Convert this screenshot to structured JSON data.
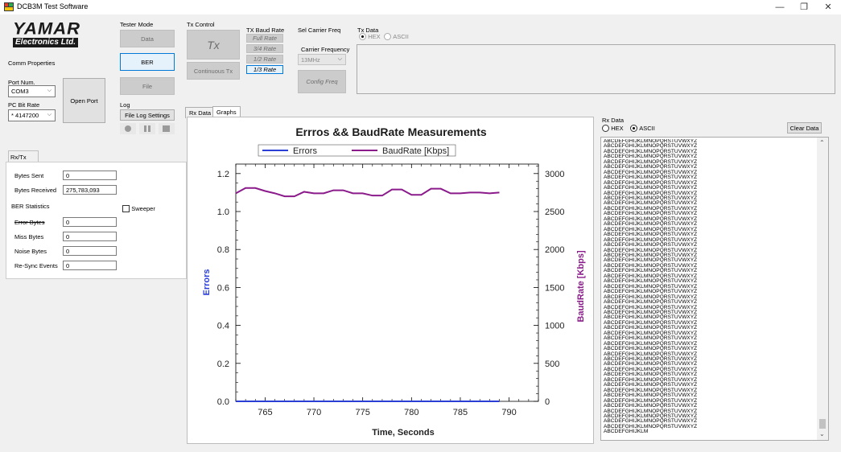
{
  "window": {
    "title": "DCB3M Test Software",
    "minimize": "—",
    "maximize": "❐",
    "close": "✕"
  },
  "logo": {
    "line1": "YAMAR",
    "line2": "Electronics Ltd."
  },
  "comm": {
    "title": "Comm Properties",
    "port_label": "Port Num.",
    "port_value": "COM3",
    "rate_label": "PC Bit Rate",
    "rate_value": "* 4147200",
    "open_port": "Open Port"
  },
  "tester_mode": {
    "title": "Tester Mode",
    "data": "Data",
    "ber": "BER",
    "file": "File"
  },
  "log": {
    "title": "Log",
    "settings": "File Log Settings"
  },
  "tx_control": {
    "title": "Tx Control",
    "tx": "Tx",
    "continuous": "Continuous Tx"
  },
  "tx_baud": {
    "title": "TX Baud Rate",
    "options": [
      "Full Rate",
      "3/4 Rate",
      "1/2 Rate",
      "1/3 Rate"
    ]
  },
  "carrier": {
    "title": "Sel Carrier Freq",
    "label": "Carrier Frequency",
    "value": "13MHz",
    "config": "Config Freq"
  },
  "tx_data": {
    "title": "Tx Data",
    "hex": "HEX",
    "ascii": "ASCII"
  },
  "rxtx_ber": {
    "tab": "Rx/Tx BER",
    "bytes_sent_label": "Bytes Sent",
    "bytes_sent": "0",
    "bytes_received_label": "Bytes Received",
    "bytes_received": "275,783,093",
    "stats_title": "BER Statistics",
    "sweeper": "Sweeper",
    "error_bytes_label": "Error Bytes",
    "error_bytes": "0",
    "miss_bytes_label": "Miss Bytes",
    "miss_bytes": "0",
    "noise_bytes_label": "Noise Bytes",
    "noise_bytes": "0",
    "resync_label": "Re-Sync Events",
    "resync": "0"
  },
  "tabs": {
    "rx_data": "Rx Data",
    "graphs": "Graphs"
  },
  "rx_panel": {
    "title": "Rx Data",
    "hex": "HEX",
    "ascii": "ASCII",
    "clear": "Clear Data",
    "line": "ABCDEFGHIJKLMNOPQRSTUVWXYZ",
    "last_line": "ABCDEFGHIJKLM"
  },
  "colors": {
    "errors": "#2b3fd6",
    "baud": "#8b1a8b"
  },
  "chart_data": {
    "type": "line",
    "title": "Errros && BaudRate Measurements",
    "xlabel": "Time, Seconds",
    "ylabel": "Errors",
    "y2label": "BaudRate [Kbps]",
    "xlim": [
      762,
      793
    ],
    "ylim": [
      0,
      1.25
    ],
    "y2lim": [
      0,
      3125
    ],
    "x_ticks": [
      765,
      770,
      775,
      780,
      785,
      790
    ],
    "y_ticks": [
      "0.0",
      "0.2",
      "0.4",
      "0.6",
      "0.8",
      "1.0",
      "1.2"
    ],
    "y2_ticks": [
      "0",
      "500",
      "1000",
      "1500",
      "2000",
      "2500",
      "3000"
    ],
    "legend": "top",
    "series": [
      {
        "name": "Errors",
        "axis": "left",
        "x": [
          762,
          764,
          766,
          768,
          770,
          772,
          774,
          776,
          778,
          780,
          782,
          784,
          786,
          788,
          789
        ],
        "values": [
          0,
          0,
          0,
          0,
          0,
          0,
          0,
          0,
          0,
          0,
          0,
          0,
          0,
          0,
          0
        ]
      },
      {
        "name": "BaudRate [Kbps]",
        "axis": "right",
        "x": [
          762,
          763,
          764,
          765,
          766,
          767,
          768,
          769,
          770,
          771,
          772,
          773,
          774,
          775,
          776,
          777,
          778,
          779,
          780,
          781,
          782,
          783,
          784,
          785,
          786,
          787,
          788,
          789
        ],
        "values": [
          2740,
          2810,
          2810,
          2770,
          2740,
          2700,
          2700,
          2760,
          2740,
          2740,
          2780,
          2780,
          2740,
          2740,
          2710,
          2710,
          2790,
          2790,
          2720,
          2720,
          2800,
          2800,
          2740,
          2740,
          2750,
          2750,
          2740,
          2750
        ]
      }
    ]
  }
}
